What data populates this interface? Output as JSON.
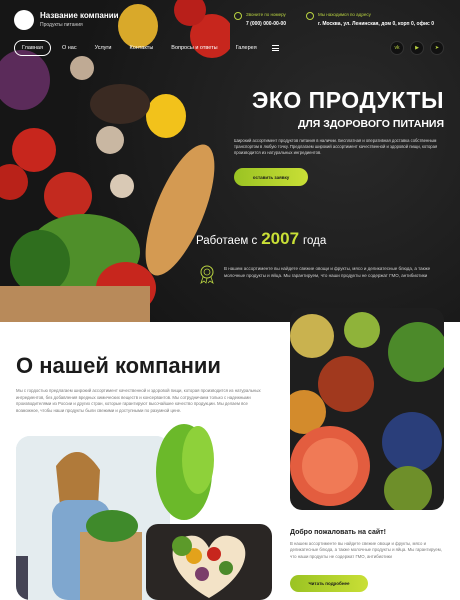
{
  "header": {
    "company_name": "Название компании",
    "company_sub": "Продукты питания",
    "phone_label": "Звоните по номеру",
    "phone": "7 (000) 000-00-00",
    "address_label": "Мы находимся по адресу",
    "address": "г. Москва, ул. Ленинская, дом 0, корп 0, офис 0"
  },
  "nav": {
    "items": [
      "Главная",
      "О нас",
      "Услуги",
      "Контакты",
      "Вопросы и ответы",
      "Галерея"
    ],
    "social": [
      "vk",
      "youtube",
      "telegram"
    ]
  },
  "hero": {
    "title": "ЭКО ПРОДУКТЫ",
    "subtitle": "ДЛЯ ЗДОРОВОГО ПИТАНИЯ",
    "description": "Широкий ассортимент продуктов питания в наличии. Бесплатная и оперативная доставка собственным транспортом в любую точку. Предлагаем широкий ассортимент качественной и здоровой пищи, которая производится из натуральных ингредиентов.",
    "button": "оставить заявку",
    "since_prefix": "Работаем с",
    "since_year": "2007",
    "since_suffix": "года",
    "note": "В нашем ассортименте вы найдете свежие овощи и фрукты, мясо и деликатесные блюда, а также молочные продукты и яйца. Мы гарантируем, что наши продукты не содержат ГМО, антибиотики"
  },
  "about": {
    "title": "О нашей компании",
    "text": "Мы с гордостью предлагаем широкий ассортимент качественной и здоровой пищи, которая производится из натуральных ингредиентов, без добавления вредных химических веществ и консервантов. Мы сотрудничаем только с надежными производителями из России и других стран, которые гарантируют высочайшее качество продукции. Мы делаем все возможное, чтобы наши продукты были свежими и доступными по разумной цене.",
    "welcome_title": "Добро пожаловать на сайт!",
    "welcome_text": "В нашем ассортименте вы найдете свежие овощи и фрукты, мясо и деликатесные блюда, а также молочные продукты и яйца. Мы гарантируем, что наши продукты не содержат ГМО, антибиотики",
    "read_button": "Читать подробнее"
  },
  "colors": {
    "accent": "#b9d341",
    "dark": "#1b1b1b"
  },
  "icons": [
    "phone-icon",
    "location-icon",
    "award-icon",
    "menu-icon"
  ]
}
